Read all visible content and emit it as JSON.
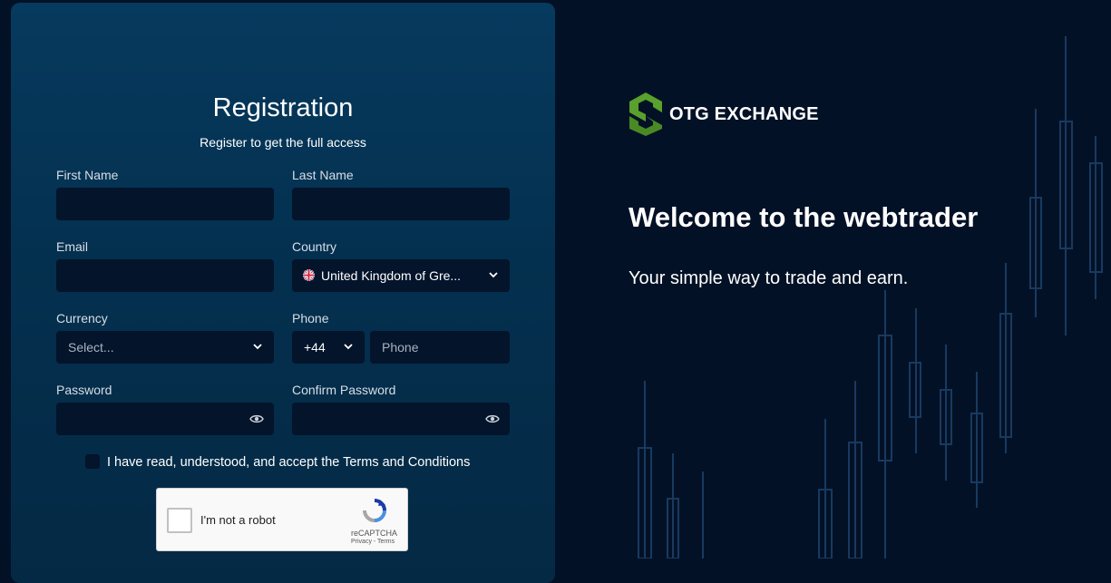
{
  "form": {
    "title": "Registration",
    "subtitle": "Register to get the full access",
    "first_name_label": "First Name",
    "last_name_label": "Last Name",
    "email_label": "Email",
    "country_label": "Country",
    "country_value": "United Kingdom of Gre...",
    "currency_label": "Currency",
    "currency_value": "Select...",
    "phone_label": "Phone",
    "phone_code": "+44",
    "phone_placeholder": "Phone",
    "password_label": "Password",
    "confirm_password_label": "Confirm Password",
    "terms_text": "I have read, understood, and accept the Terms and Conditions"
  },
  "captcha": {
    "label": "I'm not a robot",
    "brand": "reCAPTCHA",
    "links": "Privacy - Terms"
  },
  "brand": {
    "name": "OTG EXCHANGE",
    "logo_color": "#5aa02c"
  },
  "hero": {
    "heading": "Welcome to the webtrader",
    "tagline": "Your simple way to trade and earn."
  },
  "icons": {
    "select_chevron": "chevron-down-icon",
    "password_toggle": "eye-icon",
    "country_flag": "uk-flag-icon"
  },
  "colors": {
    "background": "#031126",
    "panel": "#063a5e",
    "input": "#03142b"
  }
}
